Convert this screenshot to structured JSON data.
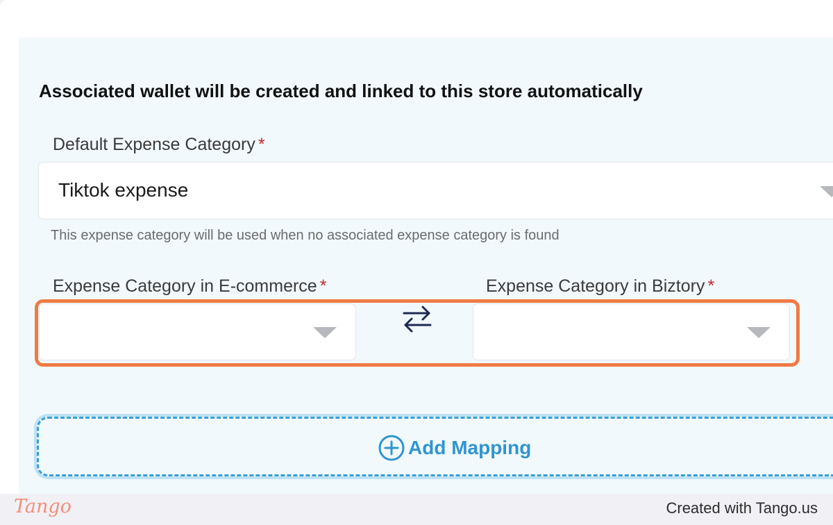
{
  "heading": "Associated wallet will be created and linked to this store automatically",
  "default_category": {
    "label": "Default Expense Category",
    "required_mark": "*",
    "value": "Tiktok expense",
    "hint": "This expense category will be used when no associated expense category is found"
  },
  "mapping": {
    "ecommerce_label": "Expense Category in E-commerce",
    "biztory_label": "Expense Category in Biztory",
    "required_mark": "*",
    "ecommerce_value": "",
    "biztory_value": ""
  },
  "add_mapping": {
    "label": "Add Mapping"
  },
  "footer": {
    "logo": "Tango",
    "credit": "Created with Tango.us"
  },
  "colors": {
    "highlight": "#f07a45",
    "accent": "#2f95cf",
    "panel": "#f2f9fd",
    "required": "#c62828"
  },
  "icons": [
    "swap-arrows-icon",
    "plus-circle-icon",
    "caret-down-icon"
  ]
}
